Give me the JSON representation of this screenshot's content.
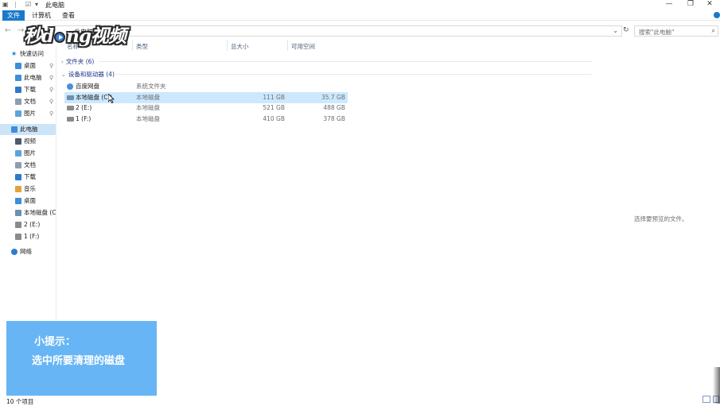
{
  "window": {
    "title": "此电脑",
    "controls": {
      "minimize": "—",
      "maximize": "❐",
      "close": "✕"
    }
  },
  "ribbon": {
    "tabs": [
      {
        "label": "文件",
        "active": true
      },
      {
        "label": "计算机",
        "active": false
      },
      {
        "label": "查看",
        "active": false
      }
    ]
  },
  "address": {
    "path": "此电脑",
    "search_placeholder": "搜索\"此电脑\""
  },
  "watermark": {
    "text_left": "秒d",
    "text_right": "ng视频"
  },
  "sidebar": {
    "items": [
      {
        "label": "快速访问",
        "icon": "star-icon",
        "color": "#2b7cd3",
        "pinned": false,
        "level": 0
      },
      {
        "label": "桌面",
        "icon": "desktop-icon",
        "color": "#3c8fd8",
        "pinned": true,
        "level": 1
      },
      {
        "label": "此电脑",
        "icon": "computer-icon",
        "color": "#3c8fd8",
        "pinned": true,
        "level": 1
      },
      {
        "label": "下载",
        "icon": "download-icon",
        "color": "#2c7bc9",
        "pinned": true,
        "level": 1
      },
      {
        "label": "文档",
        "icon": "documents-icon",
        "color": "#8f9db0",
        "pinned": true,
        "level": 1
      },
      {
        "label": "图片",
        "icon": "pictures-icon",
        "color": "#5ea3d8",
        "pinned": true,
        "level": 1
      },
      {
        "label": "此电脑",
        "icon": "computer-icon",
        "color": "#3c8fd8",
        "pinned": false,
        "level": 0,
        "selected": true
      },
      {
        "label": "视频",
        "icon": "videos-icon",
        "color": "#4d5b6b",
        "pinned": false,
        "level": 1
      },
      {
        "label": "图片",
        "icon": "pictures-icon",
        "color": "#5ea3d8",
        "pinned": false,
        "level": 1
      },
      {
        "label": "文档",
        "icon": "documents-icon",
        "color": "#8f9db0",
        "pinned": false,
        "level": 1
      },
      {
        "label": "下载",
        "icon": "download-icon",
        "color": "#2c7bc9",
        "pinned": false,
        "level": 1
      },
      {
        "label": "音乐",
        "icon": "music-icon",
        "color": "#e2a23a",
        "pinned": false,
        "level": 1
      },
      {
        "label": "桌面",
        "icon": "desktop-icon",
        "color": "#3c8fd8",
        "pinned": false,
        "level": 1
      },
      {
        "label": "本地磁盘 (C:",
        "icon": "windows-drive-icon",
        "color": "#6f8fb0",
        "pinned": false,
        "level": 1
      },
      {
        "label": "2 (E:)",
        "icon": "drive-icon",
        "color": "#8a8a8a",
        "pinned": false,
        "level": 1
      },
      {
        "label": "1 (F:)",
        "icon": "drive-icon",
        "color": "#8a8a8a",
        "pinned": false,
        "level": 1
      },
      {
        "label": "网络",
        "icon": "network-icon",
        "color": "#2b7cd3",
        "pinned": false,
        "level": 0
      }
    ]
  },
  "columns": {
    "name": "名称",
    "type": "类型",
    "total": "总大小",
    "free": "可用空间"
  },
  "groups": {
    "folders": "文件夹 (6)",
    "devices": "设备和驱动器 (4)"
  },
  "rows": [
    {
      "name": "百度网盘",
      "type": "系统文件夹",
      "total": "",
      "free": "",
      "icon": "cloud-drive-icon",
      "color": "#4a8ed8"
    },
    {
      "name": "本地磁盘 (C:)",
      "type": "本地磁盘",
      "total": "111 GB",
      "free": "35.7 GB",
      "icon": "windows-drive-icon",
      "color": "#6f8fb0",
      "selected": true
    },
    {
      "name": "2 (E:)",
      "type": "本地磁盘",
      "total": "521 GB",
      "free": "488 GB",
      "icon": "drive-icon",
      "color": "#8a8a8a"
    },
    {
      "name": "1 (F:)",
      "type": "本地磁盘",
      "total": "410 GB",
      "free": "378 GB",
      "icon": "drive-icon",
      "color": "#8a8a8a"
    }
  ],
  "preview": {
    "message": "选择要预览的文件。"
  },
  "status": {
    "count": "10 个项目"
  },
  "tip": {
    "title": "小提示：",
    "text": "选中所要清理的磁盘"
  },
  "colors": {
    "accent": "#1979ca",
    "selection": "#cce8ff",
    "tip_bg": "#67b5f4"
  }
}
